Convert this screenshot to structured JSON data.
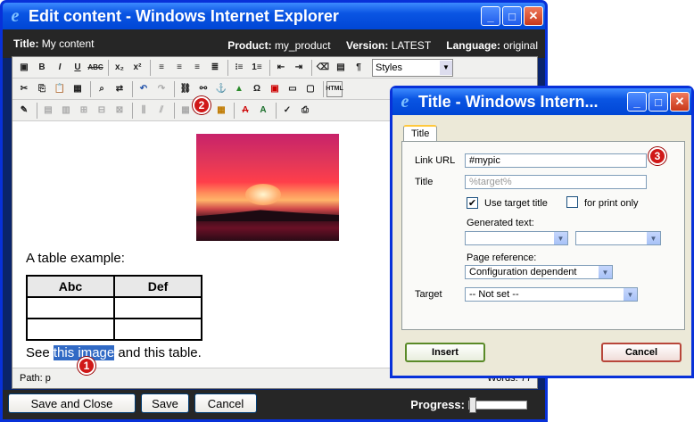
{
  "main_window": {
    "title": "Edit content - Windows Internet Explorer",
    "info": {
      "title_label": "Title:",
      "title_value": "My content",
      "product_label": "Product:",
      "product_value": "my_product",
      "version_label": "Version:",
      "version_value": "LATEST",
      "language_label": "Language:",
      "language_value": "original"
    },
    "toolbar": {
      "styles_label": "Styles",
      "html_label": "HTML"
    },
    "editor": {
      "table_caption": "A table example:",
      "table_headers": [
        "Abc",
        "Def"
      ],
      "see_prefix": "See ",
      "see_link": "this image",
      "see_suffix": " and this table."
    },
    "status": {
      "path": "Path: p",
      "words": "Words: 77"
    },
    "buttons": {
      "save_close": "Save and Close",
      "save": "Save",
      "cancel": "Cancel"
    },
    "progress_label": "Progress:",
    "progress_value": 0
  },
  "dialog": {
    "title": "Title - Windows Intern...",
    "tab": "Title",
    "link_url_label": "Link URL",
    "link_url_value": "#mypic",
    "title_label": "Title",
    "title_placeholder": "%target%",
    "use_target_title": "Use target title",
    "use_target_title_checked": true,
    "for_print_only": "for print only",
    "for_print_only_checked": false,
    "generated_text_label": "Generated text:",
    "page_reference_label": "Page reference:",
    "page_reference_value": "Configuration dependent",
    "target_label": "Target",
    "target_value": "-- Not set --",
    "insert": "Insert",
    "cancel": "Cancel"
  },
  "badges": [
    "1",
    "2",
    "3"
  ]
}
